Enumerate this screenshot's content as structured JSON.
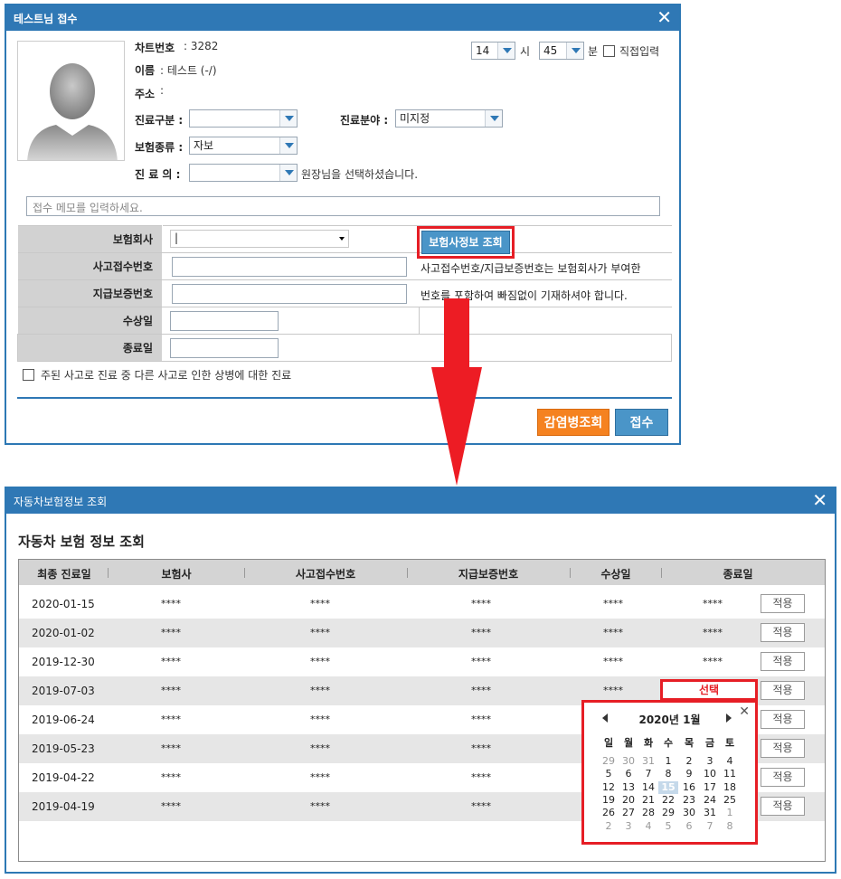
{
  "reception": {
    "title": "테스트님 접수",
    "chart_no_label": "차트번호",
    "chart_no": ": 3282",
    "name_label": "이름",
    "name_value": ": 테스트 (-/)",
    "address_label": "주소",
    "address_value": ":",
    "hour_value": "14",
    "hour_unit": "시",
    "minute_value": "45",
    "minute_unit": "분",
    "direct_input_label": "직접입력",
    "category_label": "진료구분 :",
    "category_value": "",
    "field_label": "진료분야 :",
    "field_value": "미지정",
    "insurance_type_label": "보험종류 :",
    "insurance_type_value": "자보",
    "doctor_label": "진 료 의 :",
    "doctor_value": "",
    "doctor_note": "원장님을 선택하셨습니다.",
    "memo_placeholder": "접수 메모를 입력하세요.",
    "insurer_label": "보험회사",
    "insurer_value": "|",
    "insurer_lookup_button": "보험사정보 조회",
    "accident_no_label": "사고접수번호",
    "payment_no_label": "지급보증번호",
    "note_line1": "사고접수번호/지급보증번호는 보험회사가 부여한",
    "note_line2": "번호를 포함하여 빠짐없이 기재하셔야 합니다.",
    "injury_date_label": "수상일",
    "end_date_label": "종료일",
    "other_accident_label": "주된 사고로 진료 중 다른 사고로 인한 상병에 대한 진료",
    "infection_button": "감염병조회",
    "register_button": "접수"
  },
  "lookup": {
    "title": "자동차보험정보 조회",
    "section_title": "자동차 보험 정보 조회",
    "columns": [
      "최종 진료일",
      "보험사",
      "사고접수번호",
      "지급보증번호",
      "수상일",
      "종료일"
    ],
    "rows": [
      {
        "date": "2020-01-15",
        "insurer": "****",
        "accident": "****",
        "payment": "****",
        "injury": "****",
        "end": "****"
      },
      {
        "date": "2020-01-02",
        "insurer": "****",
        "accident": "****",
        "payment": "****",
        "injury": "****",
        "end": "****"
      },
      {
        "date": "2019-12-30",
        "insurer": "****",
        "accident": "****",
        "payment": "****",
        "injury": "****",
        "end": "****"
      },
      {
        "date": "2019-07-03",
        "insurer": "****",
        "accident": "****",
        "payment": "****",
        "injury": "****",
        "end": "선택"
      },
      {
        "date": "2019-06-24",
        "insurer": "****",
        "accident": "****",
        "payment": "****",
        "injury": "",
        "end": ""
      },
      {
        "date": "2019-05-23",
        "insurer": "****",
        "accident": "****",
        "payment": "****",
        "injury": "",
        "end": ""
      },
      {
        "date": "2019-04-22",
        "insurer": "****",
        "accident": "****",
        "payment": "****",
        "injury": "",
        "end": ""
      },
      {
        "date": "2019-04-19",
        "insurer": "****",
        "accident": "****",
        "payment": "****",
        "injury": "",
        "end": ""
      }
    ],
    "apply_label": "적용",
    "calendar": {
      "month_label": "2020년 1월",
      "weekdays": [
        "일",
        "월",
        "화",
        "수",
        "목",
        "금",
        "토"
      ],
      "weeks": [
        [
          "29",
          "30",
          "31",
          "1",
          "2",
          "3",
          "4"
        ],
        [
          "5",
          "6",
          "7",
          "8",
          "9",
          "10",
          "11"
        ],
        [
          "12",
          "13",
          "14",
          "15",
          "16",
          "17",
          "18"
        ],
        [
          "19",
          "20",
          "21",
          "22",
          "23",
          "24",
          "25"
        ],
        [
          "26",
          "27",
          "28",
          "29",
          "30",
          "31",
          "1"
        ],
        [
          "2",
          "3",
          "4",
          "5",
          "6",
          "7",
          "8"
        ]
      ],
      "selected_day": "15"
    }
  }
}
